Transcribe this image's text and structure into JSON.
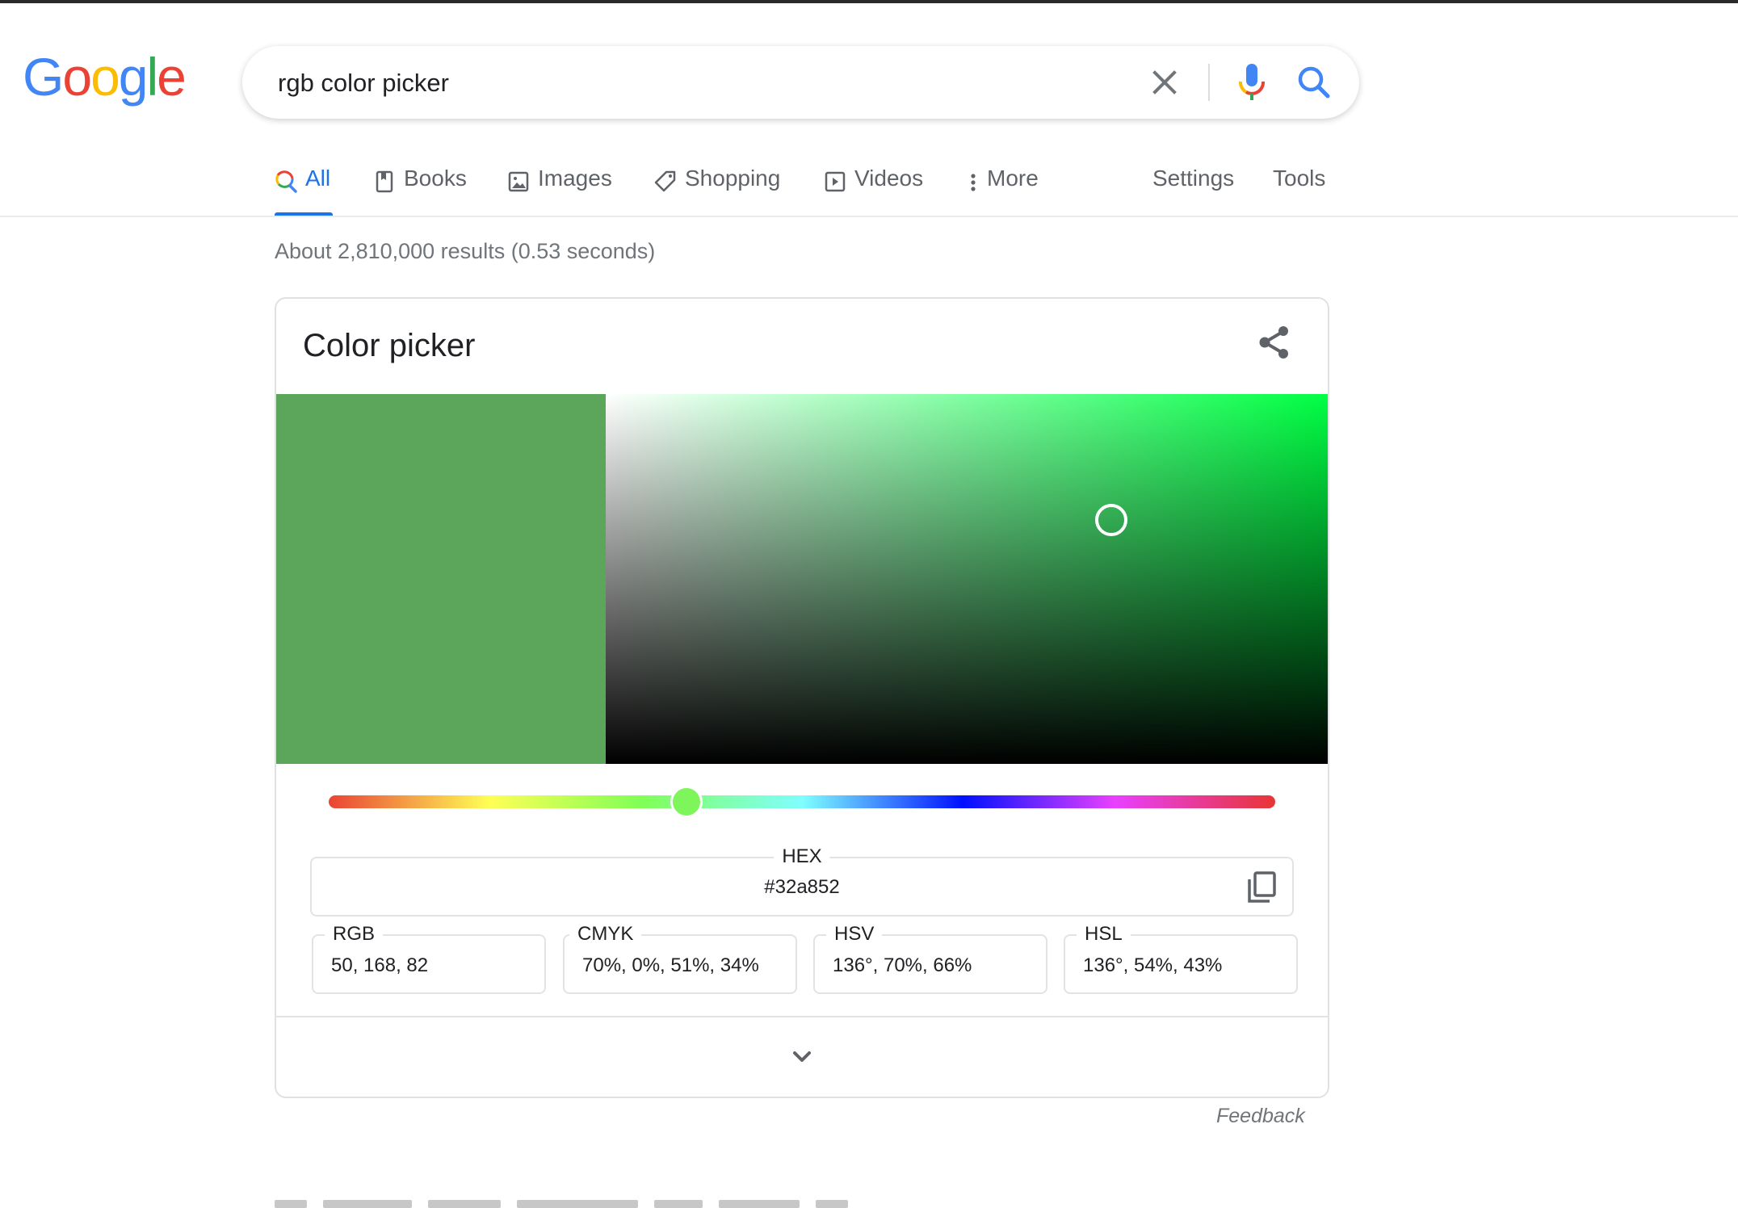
{
  "logo": {
    "letters": [
      {
        "char": "G",
        "color": "#4285f4"
      },
      {
        "char": "o",
        "color": "#ea4335"
      },
      {
        "char": "o",
        "color": "#fbbc05"
      },
      {
        "char": "g",
        "color": "#4285f4"
      },
      {
        "char": "l",
        "color": "#34a853"
      },
      {
        "char": "e",
        "color": "#ea4335"
      }
    ]
  },
  "search": {
    "query": "rgb color picker",
    "clear_icon": "close-icon",
    "mic_icon": "microphone-icon",
    "search_icon": "search-icon"
  },
  "tabs": [
    {
      "label": "All",
      "icon": "search-icon",
      "active": true
    },
    {
      "label": "Books",
      "icon": "book-icon",
      "active": false
    },
    {
      "label": "Images",
      "icon": "image-icon",
      "active": false
    },
    {
      "label": "Shopping",
      "icon": "tag-icon",
      "active": false
    },
    {
      "label": "Videos",
      "icon": "play-icon",
      "active": false
    },
    {
      "label": "More",
      "icon": "more-vert-icon",
      "active": false
    }
  ],
  "tools": {
    "settings_label": "Settings",
    "tools_label": "Tools"
  },
  "result_stats": "About 2,810,000 results (0.53 seconds)",
  "color_picker": {
    "title": "Color picker",
    "share_icon": "share-icon",
    "selected_color": "#32a852",
    "hue_base_color": "#00ff3c",
    "hue_degrees": 136,
    "saturation": 0.7,
    "value": 0.66,
    "hex": {
      "label": "HEX",
      "value": "#32a852",
      "copy_icon": "copy-icon"
    },
    "formats": [
      {
        "label": "RGB",
        "value": "50, 168, 82"
      },
      {
        "label": "CMYK",
        "value": "70%, 0%, 51%, 34%"
      },
      {
        "label": "HSV",
        "value": "136°, 70%, 66%"
      },
      {
        "label": "HSL",
        "value": "136°, 54%, 43%"
      }
    ],
    "expand_icon": "chevron-down-icon"
  },
  "feedback_label": "Feedback"
}
